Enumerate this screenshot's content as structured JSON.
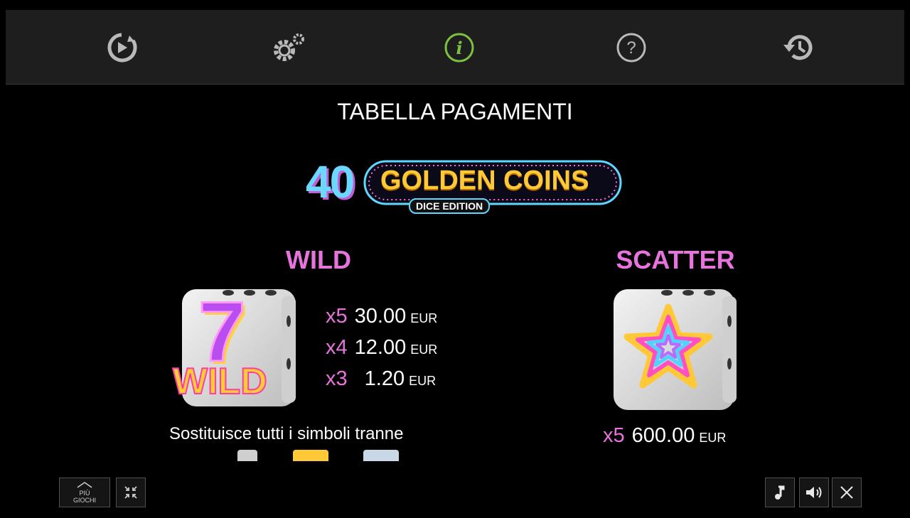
{
  "nav": {
    "icons": [
      "autoplay-icon",
      "settings-icon",
      "info-icon",
      "help-icon",
      "history-icon"
    ],
    "active_color": "#7ec142"
  },
  "page": {
    "title": "TABELLA PAGAMENTI"
  },
  "logo": {
    "number": "40",
    "main": "GOLDEN COINS",
    "sub": "DICE EDITION"
  },
  "wild": {
    "title": "WILD",
    "dice_label": "WILD",
    "dice_number": "7",
    "payouts": [
      {
        "mult": "x5",
        "value": "30.00",
        "currency": "EUR"
      },
      {
        "mult": "x4",
        "value": "12.00",
        "currency": "EUR"
      },
      {
        "mult": "x3",
        "value": "1.20",
        "currency": "EUR"
      }
    ],
    "description": "Sostituisce tutti i simboli tranne"
  },
  "scatter": {
    "title": "SCATTER",
    "payouts": [
      {
        "mult": "x5",
        "value": "600.00",
        "currency": "EUR"
      }
    ]
  },
  "bottom": {
    "more_games_line1": "PIÙ",
    "more_games_line2": "GIOCHI"
  },
  "colors": {
    "accent": "#e774dd",
    "active": "#7ec142"
  }
}
